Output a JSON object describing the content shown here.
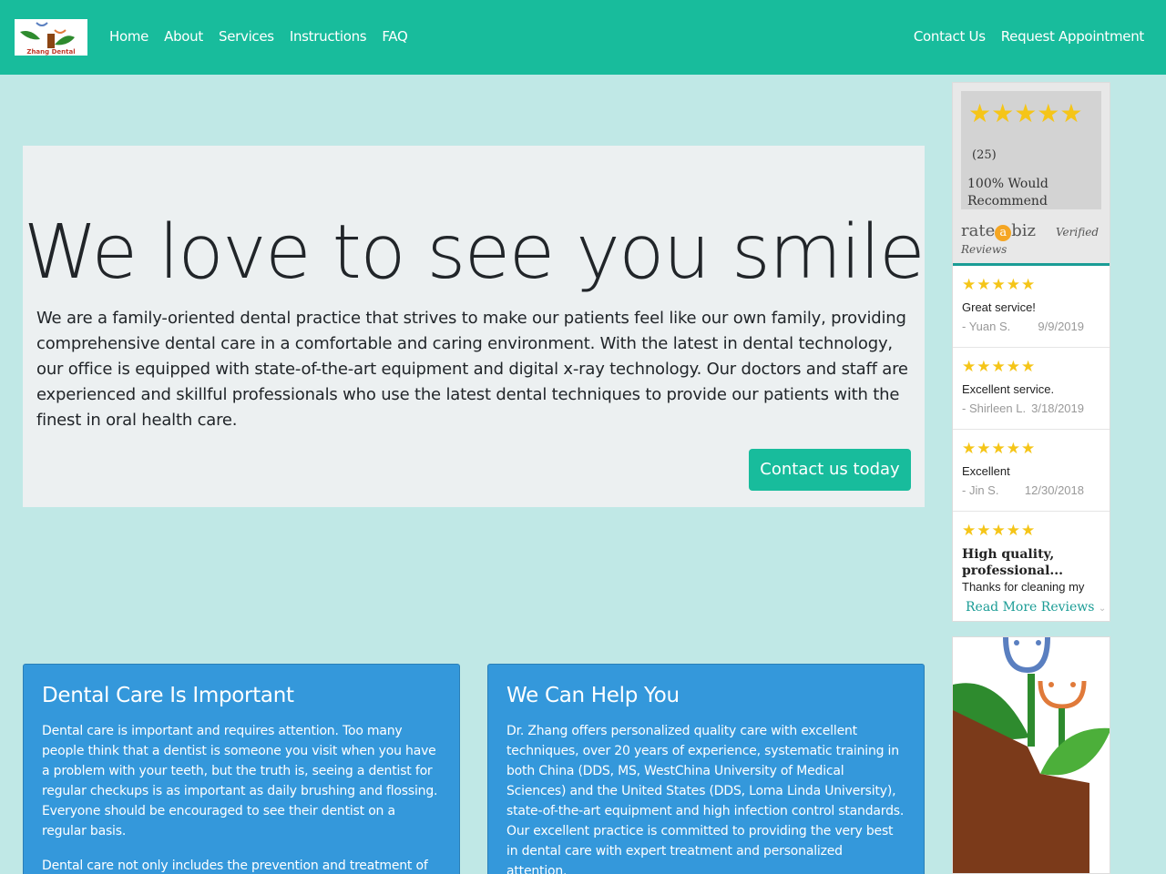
{
  "brand": {
    "logo_text": "Zhang Dental"
  },
  "nav": {
    "left": [
      "Home",
      "About",
      "Services",
      "Instructions",
      "FAQ"
    ],
    "right": [
      "Contact Us",
      "Request Appointment"
    ]
  },
  "hero": {
    "title": "We love to see you smile",
    "body": "We are a family-oriented dental practice that strives to make our patients feel like our own family, providing comprehensive dental care in a comfortable and caring environment. With the latest in dental technology, our office is equipped with state-of-the-art equipment and digital x-ray technology. Our doctors and staff are experienced and skillful professionals who use the latest dental techniques to provide our patients with the finest in oral health care.",
    "cta": "Contact us today"
  },
  "cards": [
    {
      "title": "Dental Care Is Important",
      "paragraphs": [
        "Dental care is important and requires attention. Too many people think that a dentist is someone you visit when you have a problem with your teeth, but the truth is, seeing a dentist for regular checkups is as important as daily brushing and flossing. Everyone should be encouraged to see their dentist on a regular basis.",
        "Dental care not only includes the prevention and treatment of health problems and diseases, such as gingivitis (a gum disease"
      ]
    },
    {
      "title": "We Can Help You",
      "paragraphs": [
        "Dr. Zhang offers personalized quality care with excellent techniques, over 20 years of experience, systematic training in both China (DDS, MS, WestChina University of Medical Sciences) and the United States (DDS, Loma Linda University), state-of-the-art equipment and high infection control standards. Our excellent practice is committed to providing the very best in dental care with expert treatment and personalized attention."
      ]
    }
  ],
  "widget": {
    "stars_rating": 5,
    "count": "(25)",
    "recommend": "100% Would Recommend",
    "brand_pre": "rate",
    "brand_a": "a",
    "brand_post": "biz",
    "brand_sub": "Reviews",
    "verified": "Verified",
    "reviews": [
      {
        "stars": 5,
        "text": "Great service!",
        "author": "- Yuan S.",
        "date": "9/9/2019"
      },
      {
        "stars": 5,
        "text": "Excellent service.",
        "author": "- Shirleen L.",
        "date": "3/18/2019"
      },
      {
        "stars": 5,
        "text": "Excellent",
        "author": "- Jin S.",
        "date": "12/30/2018"
      },
      {
        "stars": 5,
        "title": "High quality, professional...",
        "text": "Thanks for cleaning my"
      }
    ],
    "read_more": "Read More Reviews"
  },
  "colors": {
    "primary": "#18bc9c",
    "info": "#3498db",
    "background": "#c0e8e6",
    "star": "#f5c518"
  }
}
